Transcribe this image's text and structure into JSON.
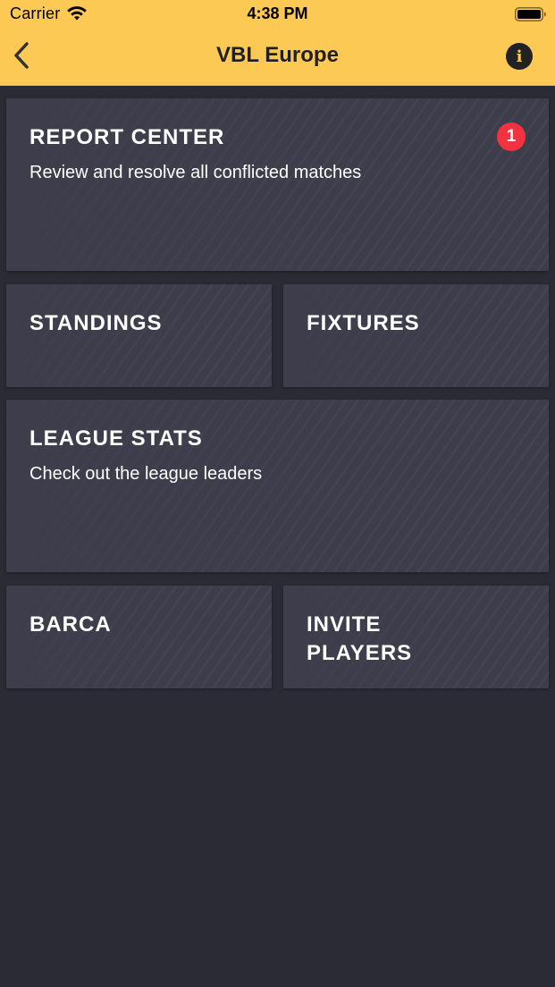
{
  "status_bar": {
    "carrier": "Carrier",
    "time": "4:38 PM"
  },
  "nav": {
    "title": "VBL Europe",
    "back_icon": "chevron-left-icon",
    "info_icon": "info-icon",
    "info_glyph": "i"
  },
  "tiles": {
    "report_center": {
      "title": "REPORT CENTER",
      "subtitle": "Review and resolve all conflicted matches",
      "badge": "1"
    },
    "standings": {
      "title": "STANDINGS"
    },
    "fixtures": {
      "title": "FIXTURES"
    },
    "league_stats": {
      "title": "LEAGUE STATS",
      "subtitle": "Check out the league leaders"
    },
    "team": {
      "title": "BARCA"
    },
    "invite_players": {
      "title_line1": "INVITE",
      "title_line2": "PLAYERS"
    }
  },
  "colors": {
    "header": "#fdc955",
    "background": "#2b2b35",
    "tile": "#3d3d4b",
    "badge": "#f2333f"
  }
}
